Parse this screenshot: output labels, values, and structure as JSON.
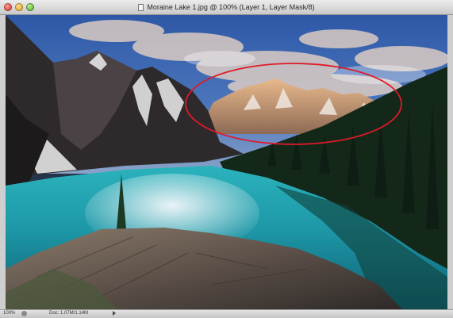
{
  "window": {
    "title": "Moraine Lake 1.jpg @ 100% (Layer 1, Layer Mask/8)"
  },
  "statusbar": {
    "zoom": "100%",
    "doc_size": "Doc: 1.07M/1.14M"
  },
  "annotation": {
    "shape": "ellipse",
    "color": "#e0192a"
  },
  "colors": {
    "titlebar": "#d8d8d8",
    "sky": "#3f67b0",
    "lake": "#1fa3ad",
    "forest": "#14281a"
  }
}
